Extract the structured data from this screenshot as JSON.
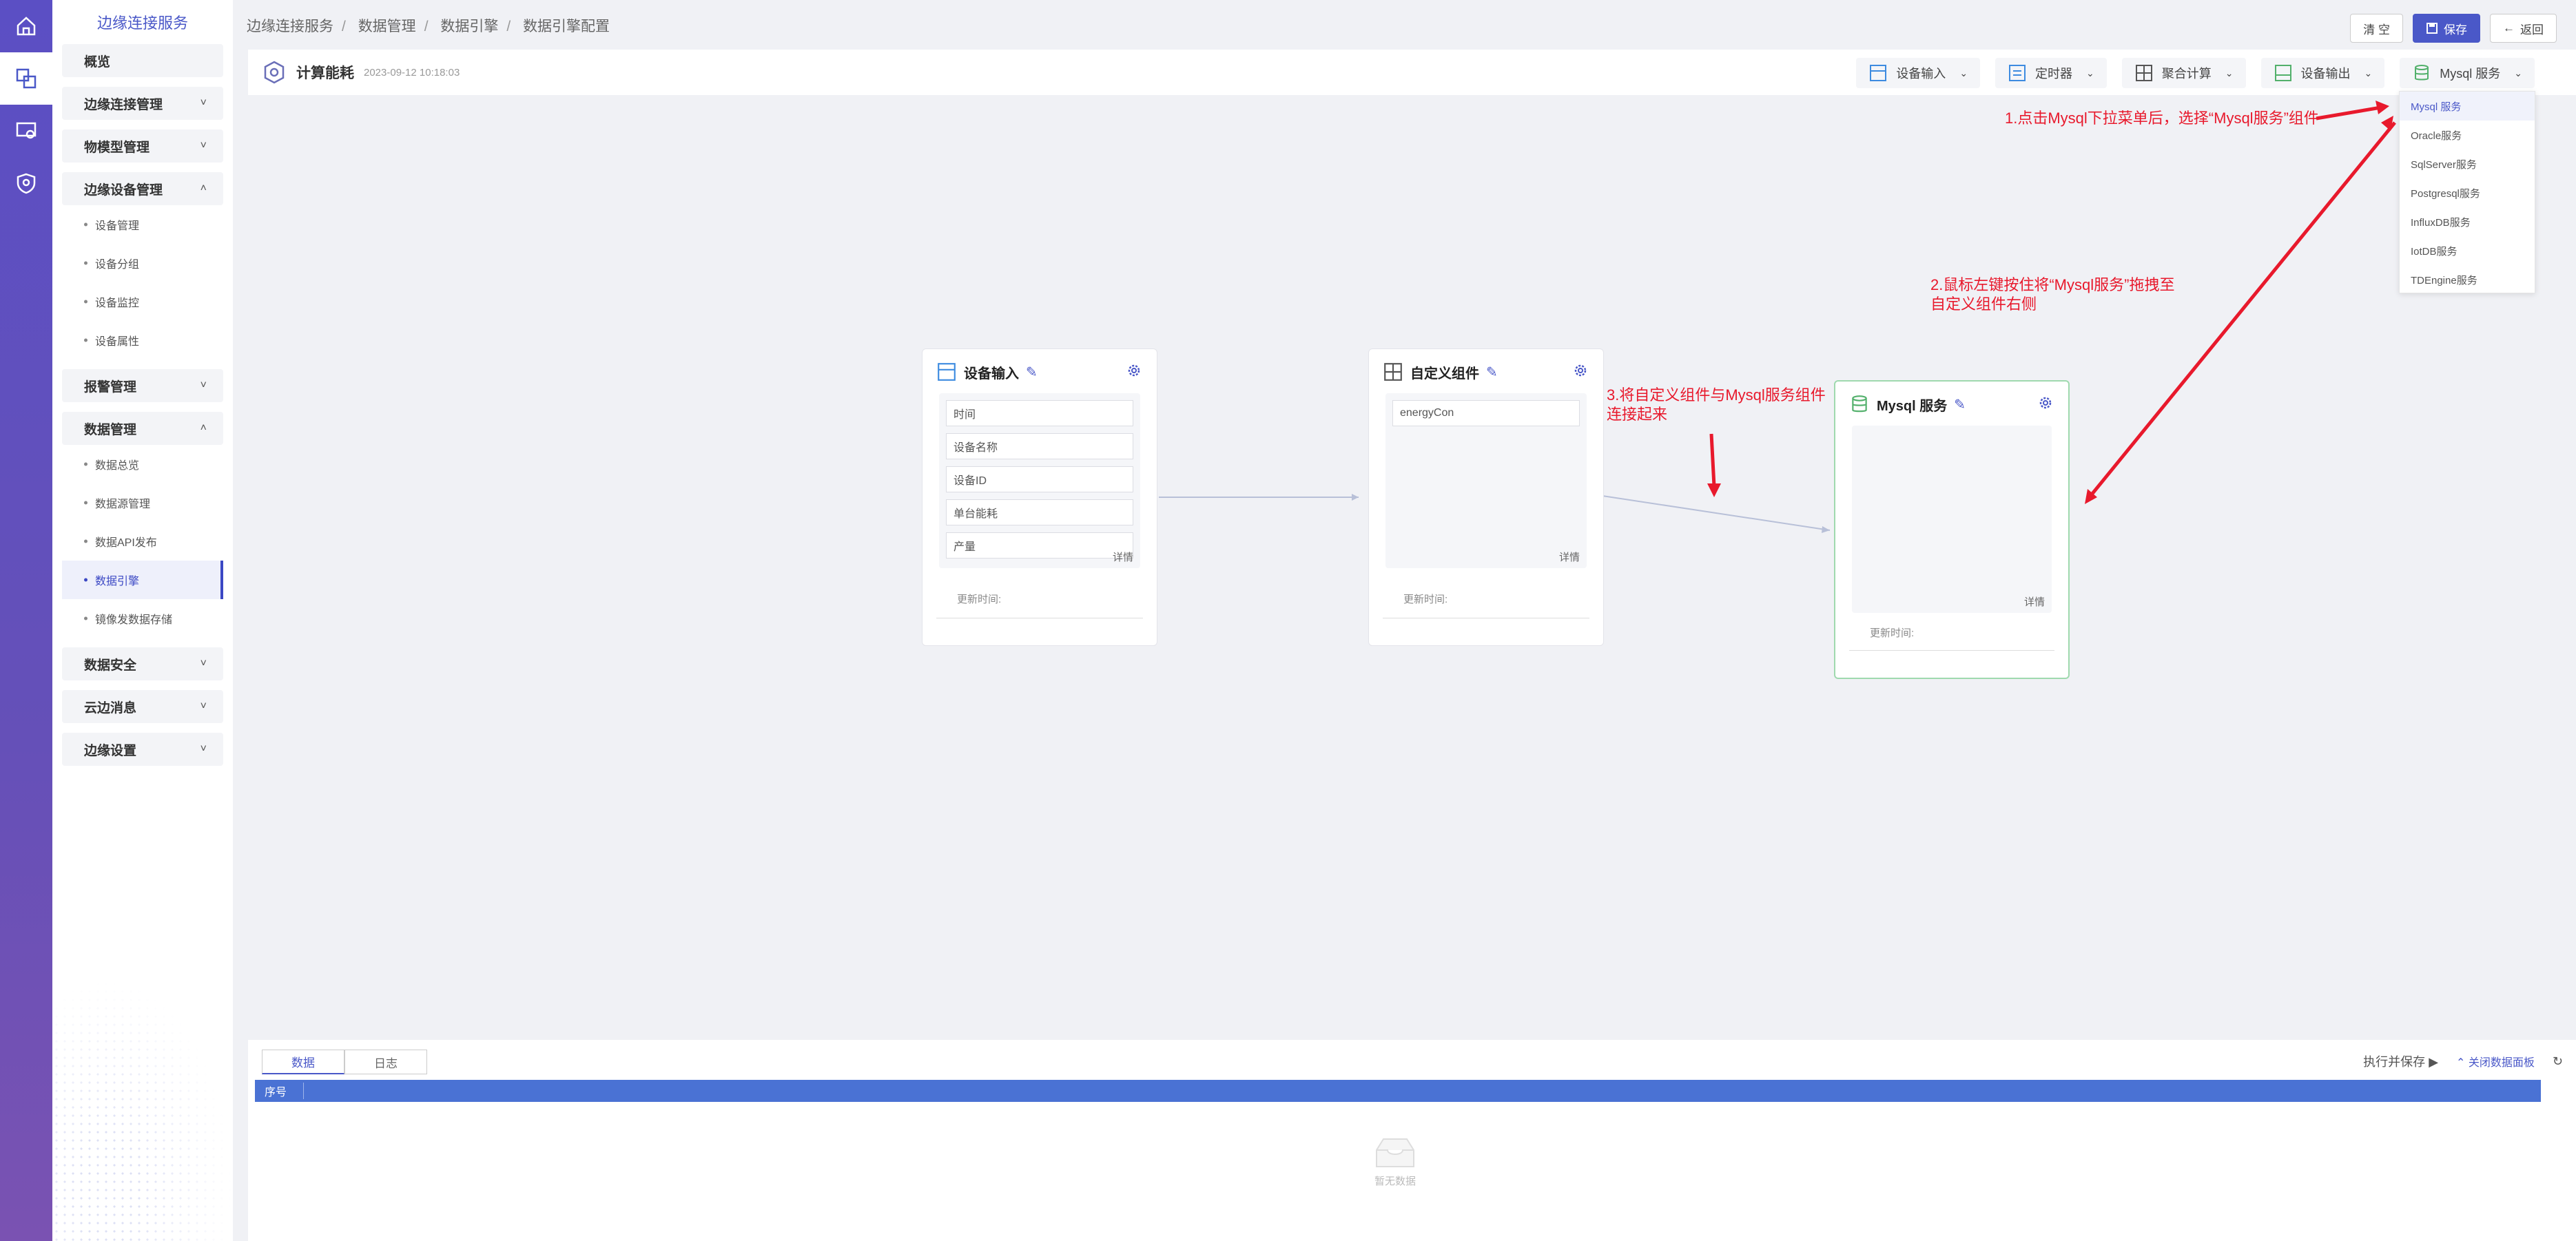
{
  "brand": "边缘连接服务",
  "rail": [
    "home-icon",
    "devices-icon",
    "monitor-icon",
    "shield-icon"
  ],
  "sidebar": {
    "overview": "概览",
    "groups": [
      {
        "label": "边缘连接管理",
        "chevron": "˅"
      },
      {
        "label": "物模型管理",
        "chevron": "˅"
      },
      {
        "label": "边缘设备管理",
        "chevron": "˄"
      }
    ],
    "device_items": [
      "设备管理",
      "设备分组",
      "设备监控",
      "设备属性"
    ],
    "alarm": "报警管理",
    "data_mgmt": "数据管理",
    "data_items": [
      "数据总览",
      "数据源管理",
      "数据API发布",
      "数据引擎",
      "镜像发数据存储"
    ],
    "tail_groups": [
      "数据安全",
      "云边消息",
      "边缘设置"
    ]
  },
  "breadcrumb": [
    "边缘连接服务",
    "数据管理",
    "数据引擎",
    "数据引擎配置"
  ],
  "top_buttons": {
    "clear": "清 空",
    "save": "保存",
    "back": "返回"
  },
  "title": {
    "name": "计算能耗",
    "time": "2023-09-12 10:18:03"
  },
  "tools": [
    {
      "label": "设备输入",
      "color": "#3d8be0"
    },
    {
      "label": "定时器",
      "color": "#3d8be0"
    },
    {
      "label": "聚合计算",
      "color": "#555"
    },
    {
      "label": "设备输出",
      "color": "#52b06b"
    },
    {
      "label": "Mysql 服务",
      "color": "#52b06b"
    }
  ],
  "dropdown": [
    "Mysql 服务",
    "Oracle服务",
    "SqlServer服务",
    "Postgresql服务",
    "InfluxDB服务",
    "IotDB服务",
    "TDEngine服务"
  ],
  "nodes": {
    "input": {
      "title": "设备输入",
      "fields": [
        "时间",
        "设备名称",
        "设备ID",
        "单台能耗",
        "产量"
      ],
      "detail": "详情",
      "updated": "更新时间:"
    },
    "custom": {
      "title": "自定义组件",
      "fields": [
        "energyCon"
      ],
      "detail": "详情",
      "updated": "更新时间:"
    },
    "mysql": {
      "title": "Mysql 服务",
      "detail": "详情",
      "updated": "更新时间:"
    }
  },
  "annotations": {
    "a1": "1.点击Mysql下拉菜单后，选择“Mysql服务”组件",
    "a2_1": "2.鼠标左键按住将“Mysql服务”拖拽至",
    "a2_2": "自定义组件右侧",
    "a3_1": "3.将自定义组件与Mysql服务组件",
    "a3_2": "连接起来"
  },
  "panel": {
    "tabs": [
      "数据",
      "日志"
    ],
    "run_save": "执行并保存",
    "close_panel": "关闭数据面板",
    "col_index": "序号",
    "empty": "暂无数据"
  }
}
